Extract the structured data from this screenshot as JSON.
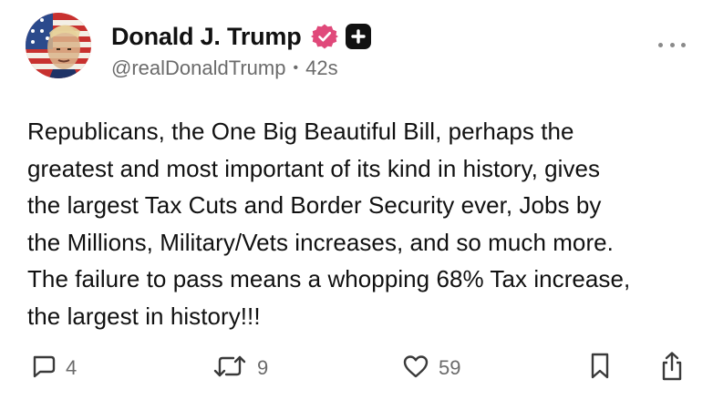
{
  "author": {
    "display_name": "Donald J. Trump",
    "handle": "@realDonaldTrump",
    "time_ago": "42s",
    "separator": "•"
  },
  "icons": {
    "verified": "verified-badge-icon",
    "plus": "plus-badge-icon",
    "more": "more-options-icon",
    "reply": "reply-icon",
    "repost": "repost-icon",
    "like": "heart-icon",
    "bookmark": "bookmark-icon",
    "share": "share-icon"
  },
  "colors": {
    "verified": "#e0497a",
    "secondary_text": "#6b6b6b",
    "text": "#111111"
  },
  "post": {
    "lines": [
      "Republicans, the One Big Beautiful Bill, perhaps the",
      "greatest and most important of its kind in history, gives",
      "the largest Tax Cuts and Border Security ever, Jobs by",
      "the Millions, Military/Vets increases, and so much more.",
      "The failure to pass means a whopping 68% Tax increase,",
      "the largest in history!!!"
    ]
  },
  "stats": {
    "replies": "4",
    "reposts": "9",
    "likes": "59"
  }
}
